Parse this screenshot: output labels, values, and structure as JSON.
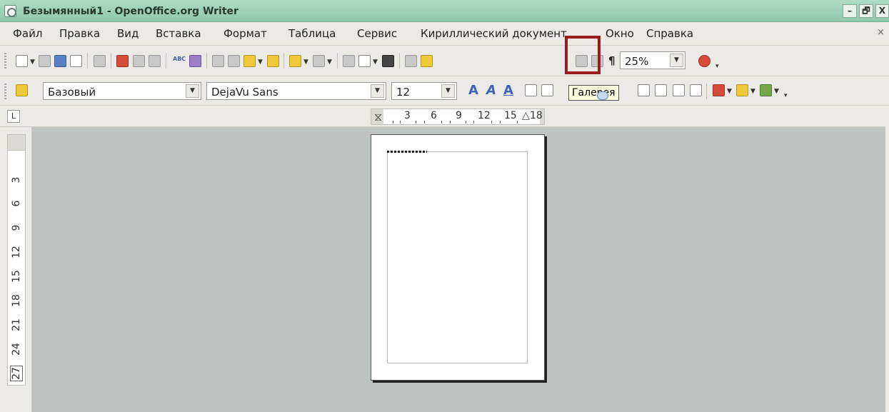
{
  "window": {
    "title": "Безымянный1 - OpenOffice.org Writer",
    "minimize_glyph": "–",
    "maximize_glyph": "🗗",
    "close_glyph": "X"
  },
  "menu": {
    "items": [
      "Файл",
      "Правка",
      "Вид",
      "Вставка",
      "Формат",
      "Таблица",
      "Сервис",
      "Кириллический документ",
      "Окно",
      "Справка"
    ],
    "close_glyph": "×"
  },
  "standard_toolbar": {
    "zoom_value": "25%",
    "formatting_marks_glyph": "¶",
    "spellcheck_label": "ABC"
  },
  "formatting_toolbar": {
    "paragraph_style": "Базовый",
    "font_name": "DejaVu Sans",
    "font_size": "12",
    "font_effect_glyph": "A"
  },
  "tooltip": {
    "text": "Галерея"
  },
  "rulers": {
    "tab_stop_glyph": "L",
    "horizontal_numbers": [
      "3",
      "6",
      "9",
      "12",
      "15",
      "18"
    ],
    "vertical_numbers": [
      "3",
      "6",
      "9",
      "12",
      "15",
      "18",
      "21",
      "24",
      "27"
    ]
  },
  "colors": {
    "highlight_border": "#9b1c1c",
    "titlebar": "#9fd1ba",
    "workspace": "#bfc3c2"
  }
}
